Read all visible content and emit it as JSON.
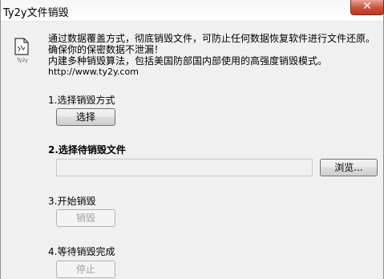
{
  "window": {
    "title": "Ty2y文件销毁",
    "close_glyph": "✕"
  },
  "intro": {
    "icon": "document-icon",
    "icon_caption": "Ty2y",
    "line1": "通过数据覆盖方式，彻底销毁文件，可防止任何数据恢复软件进行文件还原。",
    "line2": "确保你的保密数据不泄漏！",
    "line3": "内建多种销毁算法，包括美国防部国内部使用的高强度销毁模式。",
    "url": "http://www.ty2y.com"
  },
  "steps": {
    "step1": {
      "label": "1.选择销毁方式",
      "button": "选择"
    },
    "step2": {
      "label": "2.选择待销毁文件",
      "file_value": "",
      "browse_button": "浏览..."
    },
    "step3": {
      "label": "3.开始销毁",
      "button": "销毁"
    },
    "step4": {
      "label": "4.等待销毁完成",
      "button": "停止"
    }
  }
}
